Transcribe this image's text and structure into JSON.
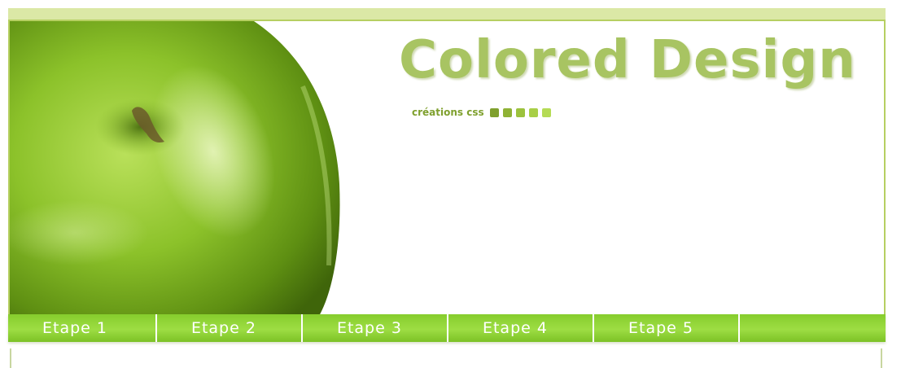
{
  "header": {
    "title": "Colored Design",
    "tagline": "créations css"
  },
  "colors": {
    "accent": "#8cd13a",
    "title": "#a8c462",
    "tagline": "#7fa02e",
    "squares": [
      "#7fa02e",
      "#8fb235",
      "#9cc23d",
      "#a8cf47",
      "#b5db55"
    ]
  },
  "nav": {
    "items": [
      {
        "label": "Etape 1"
      },
      {
        "label": "Etape 2"
      },
      {
        "label": "Etape 3"
      },
      {
        "label": "Etape 4"
      },
      {
        "label": "Etape 5"
      },
      {
        "label": ""
      }
    ]
  }
}
